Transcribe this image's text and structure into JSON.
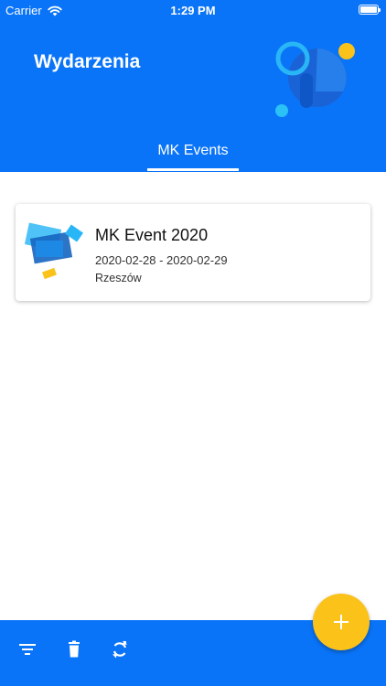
{
  "status_bar": {
    "carrier": "Carrier",
    "time": "1:29 PM"
  },
  "header": {
    "title": "Wydarzenia",
    "deco_icon": "abstract-circles-illustration"
  },
  "tabs": [
    {
      "label": "MK Events",
      "selected": true
    }
  ],
  "events": [
    {
      "title": "MK Event 2020",
      "dates": "2020-02-28 - 2020-02-29",
      "location": "Rzeszów",
      "thumbnail_icon": "event-shapes-illustration"
    }
  ],
  "bottom_bar": {
    "actions": [
      {
        "name": "filter-icon"
      },
      {
        "name": "trash-icon"
      },
      {
        "name": "refresh-icon"
      }
    ]
  },
  "fab": {
    "icon": "plus-icon"
  },
  "colors": {
    "primary": "#0a74f8",
    "accent": "#fbc21a",
    "surface": "#ffffff"
  }
}
